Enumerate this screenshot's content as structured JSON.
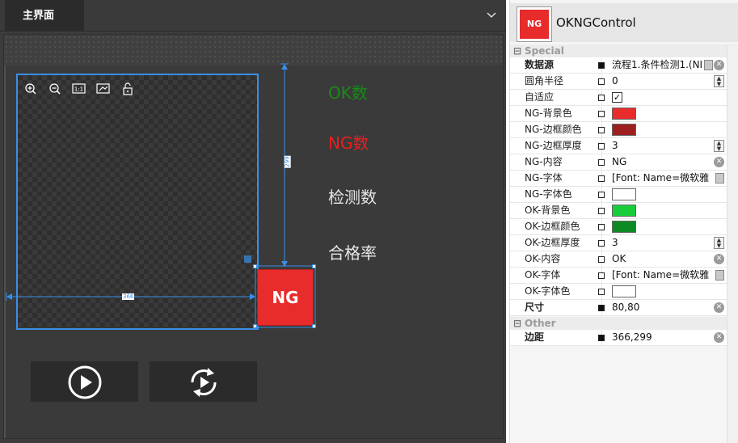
{
  "tab": {
    "label": "主界面"
  },
  "viewer_tools": [
    {
      "name": "zoom-in-icon"
    },
    {
      "name": "zoom-out-icon"
    },
    {
      "name": "actual-size-icon",
      "text": "1:1"
    },
    {
      "name": "fit-window-icon"
    },
    {
      "name": "unlock-icon"
    }
  ],
  "stats": {
    "ok_count": "OK数",
    "ng_count": "NG数",
    "inspect_count": "检测数",
    "pass_rate": "合格率"
  },
  "ng_control": {
    "label": "NG"
  },
  "dimensions": {
    "width_label": "366",
    "height_label": "299"
  },
  "colors": {
    "ok_text": "#1a8a1a",
    "ng_text": "#e62020",
    "stat_text": "#e6e6e6",
    "ng_bg": "#e82b2b",
    "ng_border": "#9e1f1f",
    "ok_bg": "#18cc3a",
    "ok_border": "#0d8a24",
    "white": "#ffffff",
    "accent": "#3a8ee6"
  },
  "properties": {
    "header_title": "OKNGControl",
    "header_thumb": "NG",
    "categories": {
      "special": "Special",
      "other": "Other"
    },
    "rows": [
      {
        "name": "数据源",
        "value": "流程1.条件检测1.(NI",
        "bold": true
      },
      {
        "name": "圆角半径",
        "value": "0"
      },
      {
        "name": "自适应",
        "value": "✓"
      },
      {
        "name": "NG-背景色",
        "value": ""
      },
      {
        "name": "NG-边框颜色",
        "value": ""
      },
      {
        "name": "NG-边框厚度",
        "value": "3"
      },
      {
        "name": "NG-内容",
        "value": "NG"
      },
      {
        "name": "NG-字体",
        "value": "[Font: Name=微软雅黑"
      },
      {
        "name": "NG-字体色",
        "value": ""
      },
      {
        "name": "OK-背景色",
        "value": ""
      },
      {
        "name": "OK-边框颜色",
        "value": ""
      },
      {
        "name": "OK-边框厚度",
        "value": "3"
      },
      {
        "name": "OK-内容",
        "value": "OK"
      },
      {
        "name": "OK-字体",
        "value": "[Font: Name=微软雅黑"
      },
      {
        "name": "OK-字体色",
        "value": ""
      },
      {
        "name": "尺寸",
        "value": "80,80",
        "bold": true
      },
      {
        "name": "边距",
        "value": "366,299",
        "bold": true
      }
    ]
  }
}
